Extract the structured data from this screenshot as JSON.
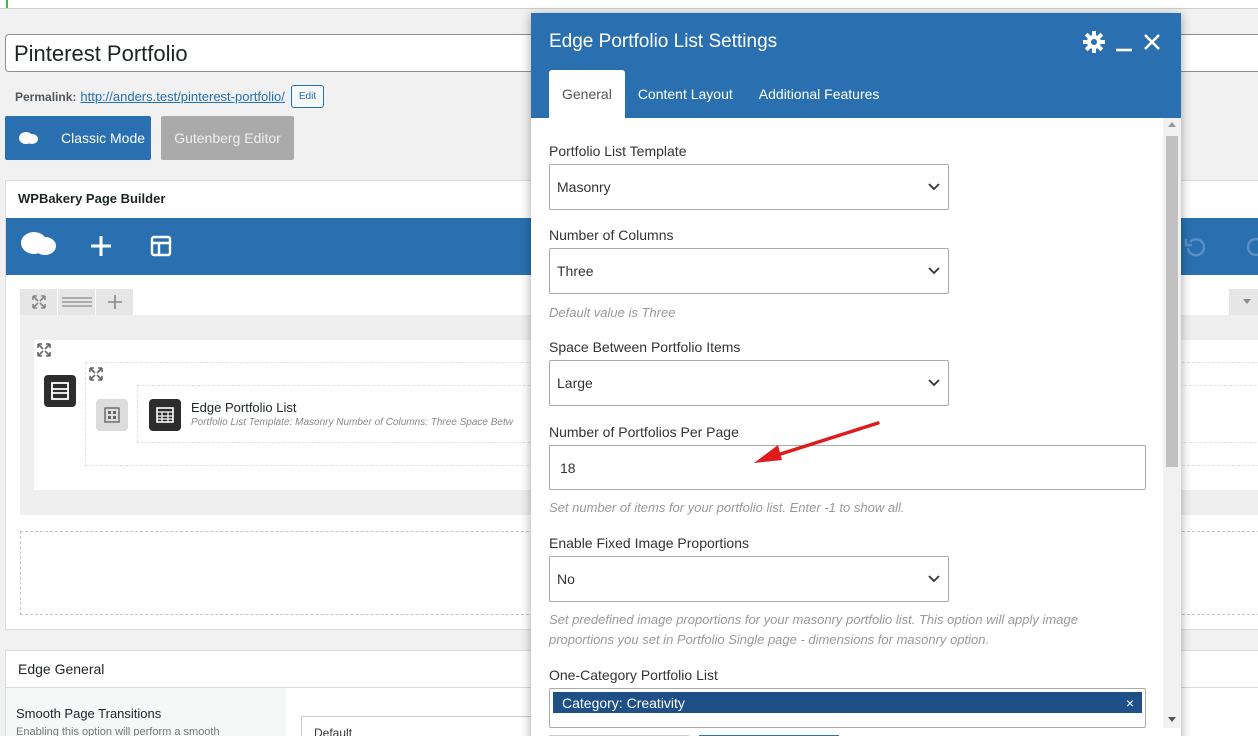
{
  "editor": {
    "post_title": "Pinterest Portfolio",
    "permalink_label": "Permalink:",
    "permalink_url": "http://anders.test/pinterest-portfolio/",
    "edit_label": "Edit",
    "classic_mode_label": "Classic Mode",
    "gutenberg_label": "Gutenberg Editor",
    "wpbakery_title": "WPBakery Page Builder",
    "element_name": "Edge Portfolio List",
    "element_desc": "Portfolio List Template: Masonry  Number of Columns: Three  Space Betw",
    "edge_general_title": "Edge General",
    "smooth_label": "Smooth Page Transitions",
    "smooth_desc": "Enabling this option will perform a smooth",
    "smooth_value": "Default"
  },
  "modal": {
    "title": "Edge Portfolio List Settings",
    "tabs": [
      {
        "label": "General",
        "active": true
      },
      {
        "label": "Content Layout",
        "active": false
      },
      {
        "label": "Additional Features",
        "active": false
      }
    ],
    "fields": {
      "template_label": "Portfolio List Template",
      "template_value": "Masonry",
      "columns_label": "Number of Columns",
      "columns_value": "Three",
      "columns_help": "Default value is Three",
      "space_label": "Space Between Portfolio Items",
      "space_value": "Large",
      "per_page_label": "Number of Portfolios Per Page",
      "per_page_value": "18",
      "per_page_help": "Set number of items for your portfolio list. Enter -1 to show all.",
      "fixed_label": "Enable Fixed Image Proportions",
      "fixed_value": "No",
      "fixed_help": "Set predefined image proportions for your masonry portfolio list. This option will apply image proportions you set in Portfolio Single page - dimensions for masonry option.",
      "category_label": "One-Category Portfolio List",
      "category_tag": "Category: Creativity",
      "tag_remove": "×"
    }
  },
  "colors": {
    "accent": "#2a70b1",
    "tag": "#1e4f87",
    "arrow": "#e01b1b"
  }
}
